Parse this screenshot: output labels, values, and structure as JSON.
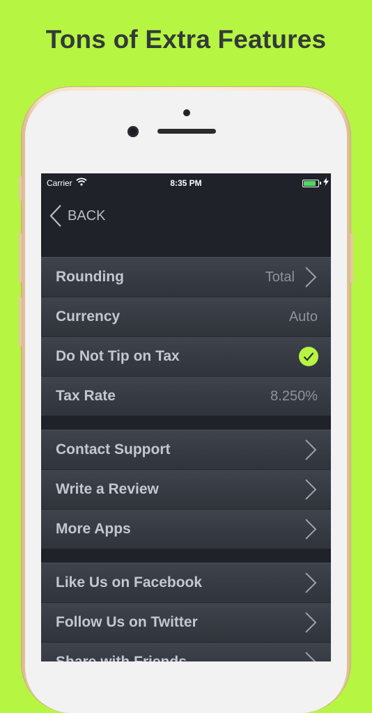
{
  "headline": "Tons of Extra Features",
  "status_bar": {
    "carrier": "Carrier",
    "time": "8:35 PM"
  },
  "nav": {
    "back_label": "BACK"
  },
  "colors": {
    "background": "#b6f541",
    "accent_check": "#b6f541",
    "screen_bg": "#1f2228"
  },
  "settings": {
    "rounding": {
      "label": "Rounding",
      "value": "Total"
    },
    "currency": {
      "label": "Currency",
      "value": "Auto"
    },
    "tip_on_tax": {
      "label": "Do Not Tip on Tax",
      "checked": true
    },
    "tax_rate": {
      "label": "Tax Rate",
      "value": "8.250%"
    }
  },
  "support": {
    "contact": "Contact Support",
    "review": "Write a Review",
    "more_apps": "More Apps"
  },
  "social": {
    "facebook": "Like Us on Facebook",
    "twitter": "Follow Us on Twitter",
    "share": "Share with Friends"
  }
}
